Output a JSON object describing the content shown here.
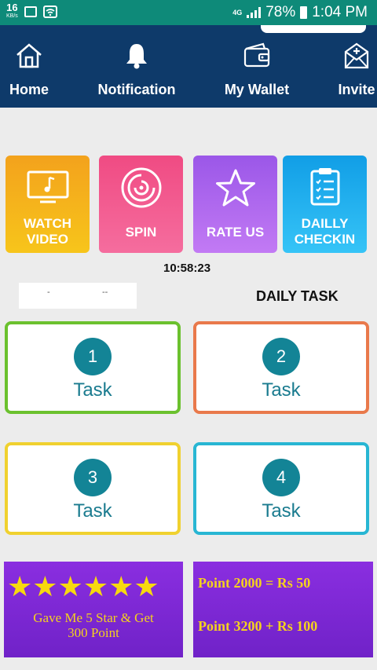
{
  "status_bar": {
    "speed_value": "16",
    "speed_unit": "KB/s",
    "network": "4G",
    "battery": "78%",
    "time": "1:04 PM"
  },
  "nav": [
    {
      "label": "Home",
      "icon": "home-icon"
    },
    {
      "label": "Notification",
      "icon": "bell-icon"
    },
    {
      "label": "My Wallet",
      "icon": "wallet-icon"
    },
    {
      "label": "Invite",
      "icon": "envelope-plus-icon"
    }
  ],
  "tiles": [
    {
      "label_line1": "WATCH",
      "label_line2": "VIDEO",
      "icon": "tv-music-icon",
      "color": "#f3a21c"
    },
    {
      "label_line1": "SPIN",
      "label_line2": "",
      "icon": "spin-disc-icon",
      "color": "#f04b83"
    },
    {
      "label_line1": "RATE US",
      "label_line2": "",
      "icon": "star-outline-icon",
      "color": "#9b57e8"
    },
    {
      "label_line1": "DAILLY",
      "label_line2": "CHECKIN",
      "icon": "clipboard-checklist-icon",
      "color": "#119ee6"
    }
  ],
  "timer": "10:58:23",
  "white_box": {
    "mark1": "-",
    "mark2": "--"
  },
  "daily_task_title": "DAILY TASK",
  "tasks": [
    {
      "number": "1",
      "label": "Task",
      "border_color": "#6bc12e"
    },
    {
      "number": "2",
      "label": "Task",
      "border_color": "#e9794b"
    },
    {
      "number": "3",
      "label": "Task",
      "border_color": "#f0d12f"
    },
    {
      "number": "4",
      "label": "Task",
      "border_color": "#28b6d3"
    }
  ],
  "banner_left": {
    "stars": "★★★★★★",
    "text_line1": "Gave Me 5 Star & Get",
    "text_line2": "300 Point"
  },
  "banner_right": {
    "line1": "Point 2000 = Rs 50",
    "line2": "Point 3200 + Rs 100"
  }
}
